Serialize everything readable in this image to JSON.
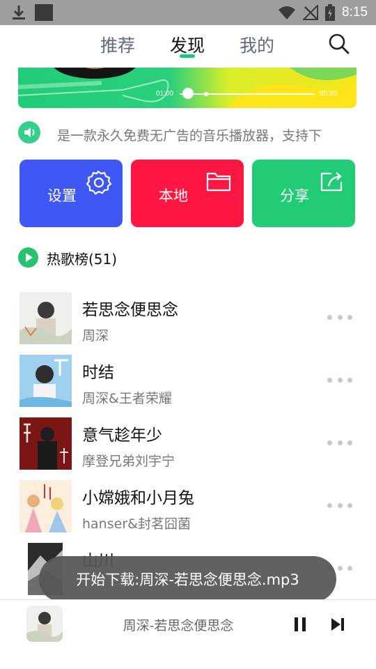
{
  "status_bar": {
    "time": "8:15",
    "icons": [
      "download-icon",
      "app-square-icon",
      "wifi-icon",
      "no-signal-icon",
      "battery-charging-icon"
    ]
  },
  "tabs": [
    {
      "label": "推荐",
      "active": false
    },
    {
      "label": "发现",
      "active": true
    },
    {
      "label": "我的",
      "active": false
    }
  ],
  "banner": {
    "time_start": "01:00",
    "time_end": "05:20"
  },
  "notice": {
    "icon": "speaker-icon",
    "text": "是一款永久免费无广告的音乐播放器，支持下"
  },
  "actions": [
    {
      "label": "设置",
      "icon": "gear-icon",
      "color": "#3f58f5"
    },
    {
      "label": "本地",
      "icon": "folder-icon",
      "color": "#ff1744"
    },
    {
      "label": "分享",
      "icon": "share-icon",
      "color": "#22cc77"
    }
  ],
  "section": {
    "title": "热歌榜(51)",
    "accent": "#26c26e"
  },
  "songs": [
    {
      "title": "若思念便思念",
      "artist": "周深"
    },
    {
      "title": "时结",
      "artist": "周深&王者荣耀"
    },
    {
      "title": "意气趁年少",
      "artist": "摩登兄弟刘宇宁"
    },
    {
      "title": "小嫦娥和小月兔",
      "artist": "hanser&封茗囧菌"
    },
    {
      "title": "山川",
      "artist": ""
    }
  ],
  "toast": {
    "text": "开始下载:周深-若思念便思念.mp3"
  },
  "player": {
    "now_playing": "周深-若思念便思念"
  }
}
